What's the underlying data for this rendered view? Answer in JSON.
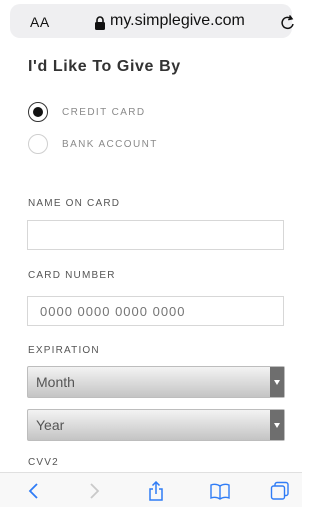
{
  "browser": {
    "text_size_label": "AA",
    "url": "my.simplegive.com"
  },
  "form": {
    "heading": "I'd Like To Give By",
    "payment_methods": [
      {
        "label": "CREDIT CARD",
        "selected": true
      },
      {
        "label": "BANK ACCOUNT",
        "selected": false
      }
    ],
    "name_on_card": {
      "label": "NAME ON CARD",
      "value": "",
      "placeholder": ""
    },
    "card_number": {
      "label": "CARD NUMBER",
      "value": "",
      "placeholder": "0000 0000 0000 0000"
    },
    "expiration": {
      "label": "EXPIRATION",
      "month": {
        "selected": "Month"
      },
      "year": {
        "selected": "Year"
      }
    },
    "cvv": {
      "label": "CVV2"
    }
  },
  "toolbar": {
    "icons": [
      "back-icon",
      "forward-icon",
      "share-icon",
      "bookmarks-icon",
      "tabs-icon"
    ]
  },
  "colors": {
    "background": "#ffffff",
    "url_bar": "#efeff1",
    "select_arrow": "#6e6e6e",
    "toolbar_icon": "#2f7cf6"
  }
}
